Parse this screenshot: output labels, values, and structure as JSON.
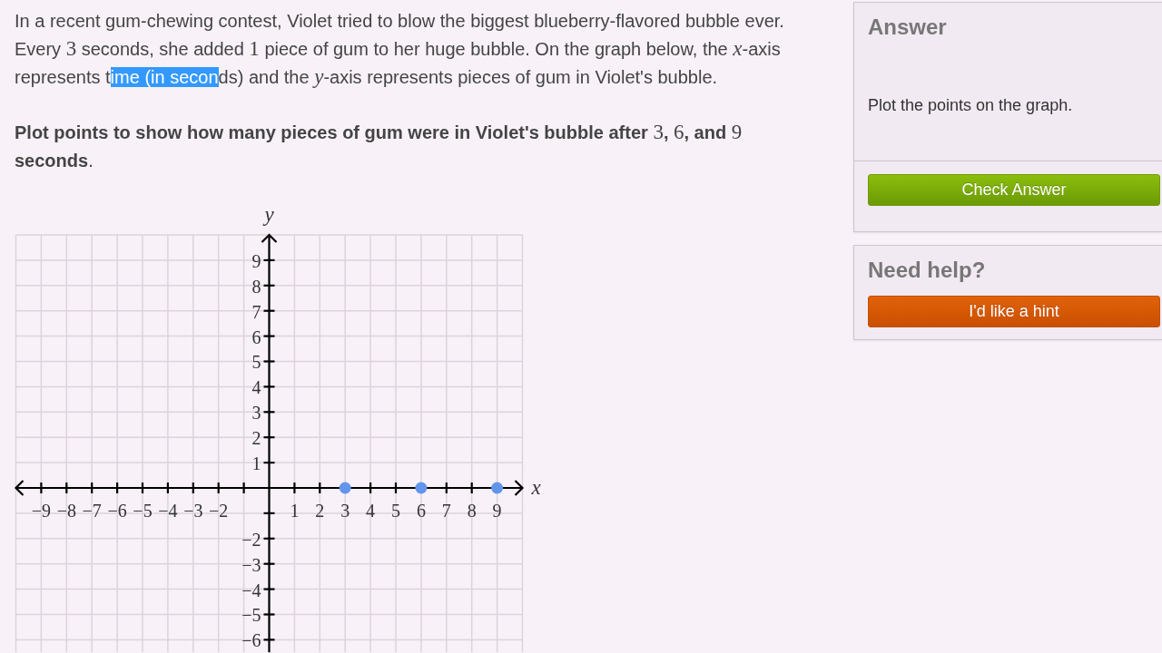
{
  "problem": {
    "paragraphs": [
      {
        "segments": [
          {
            "kind": "text",
            "text": "In a recent gum-chewing contest, Violet tried to blow the biggest blueberry-flavored bubble ever. Every "
          },
          {
            "kind": "number",
            "text": "3"
          },
          {
            "kind": "text",
            "text": " seconds, she added "
          },
          {
            "kind": "number",
            "text": "1"
          },
          {
            "kind": "text",
            "text": " piece of gum to her huge bubble. On the graph below, the "
          },
          {
            "kind": "variable",
            "text": "x"
          },
          {
            "kind": "text",
            "text": "-axis represents t"
          },
          {
            "kind": "highlight",
            "text": "ime (in secon"
          },
          {
            "kind": "text",
            "text": "ds) and the "
          },
          {
            "kind": "variable",
            "text": "y"
          },
          {
            "kind": "text",
            "text": "-axis represents pieces of gum in Violet's bubble."
          }
        ]
      },
      {
        "segments": [
          {
            "kind": "bold",
            "text": "Plot points to show how many pieces of gum were in Violet's bubble after "
          },
          {
            "kind": "number",
            "text": "3"
          },
          {
            "kind": "bold",
            "text": ", "
          },
          {
            "kind": "number",
            "text": "6"
          },
          {
            "kind": "bold",
            "text": ", and "
          },
          {
            "kind": "number",
            "text": "9"
          },
          {
            "kind": "bold",
            "text": " seconds"
          },
          {
            "kind": "text",
            "text": "."
          }
        ]
      }
    ]
  },
  "graph": {
    "chart_data": [
      {
        "type": "scatter",
        "xlabel": "x",
        "ylabel": "y",
        "x": [
          3,
          6,
          9
        ],
        "values": [
          0,
          0,
          0
        ],
        "color": "#6495ed",
        "marker": "circle",
        "grid": true,
        "xlim": [
          -10,
          10
        ],
        "ylim": [
          -6.5,
          10
        ],
        "xticks": [
          {
            "value": -9,
            "label": "−9"
          },
          {
            "value": -8,
            "label": "−8"
          },
          {
            "value": -7,
            "label": "−7"
          },
          {
            "value": -6,
            "label": "−6"
          },
          {
            "value": -5,
            "label": "−5"
          },
          {
            "value": -4,
            "label": "−4"
          },
          {
            "value": -3,
            "label": "−3"
          },
          {
            "value": -2,
            "label": "−2"
          },
          1,
          2,
          3,
          4,
          5,
          6,
          7,
          8,
          9
        ],
        "yticks": [
          {
            "value": -6,
            "label": "−6"
          },
          {
            "value": -5,
            "label": "−5"
          },
          {
            "value": -4,
            "label": "−4"
          },
          {
            "value": -3,
            "label": "−3"
          },
          {
            "value": -2,
            "label": "−2"
          },
          1,
          2,
          3,
          4,
          5,
          6,
          7,
          8,
          9
        ]
      }
    ]
  },
  "answer_panel": {
    "title": "Answer",
    "prompt": "Plot the points on the graph.",
    "button": "Check Answer"
  },
  "help_panel": {
    "title": "Need help?",
    "button": "I'd like a hint"
  }
}
